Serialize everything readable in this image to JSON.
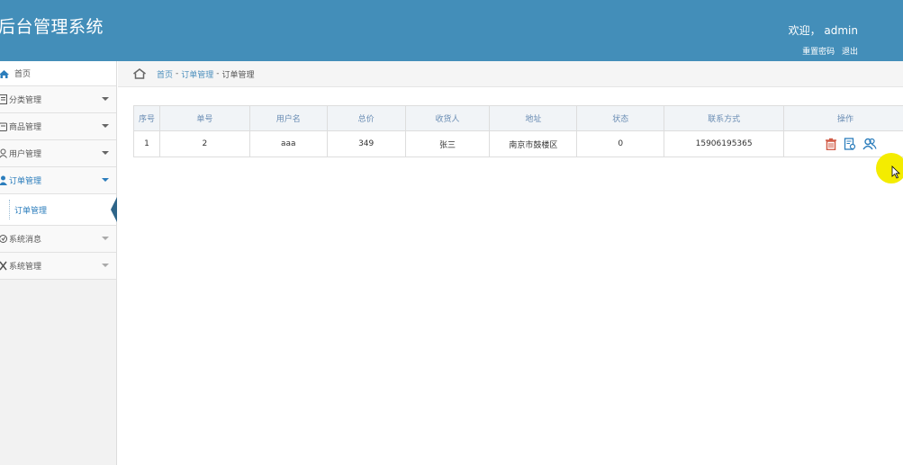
{
  "header": {
    "logo": "后台管理系统",
    "welcome": "欢迎，  admin",
    "reset_password": "重置密码",
    "logout": "退出"
  },
  "sidebar": {
    "home": "首页",
    "items": [
      {
        "label": "分类管理"
      },
      {
        "label": "商品管理"
      },
      {
        "label": "用户管理"
      },
      {
        "label": "订单管理",
        "sub": "订单管理"
      },
      {
        "label": "系统消息"
      },
      {
        "label": "系统管理"
      }
    ]
  },
  "breadcrumb": {
    "home": "首页",
    "sep": "-",
    "parent": "订单管理",
    "current": "订单管理"
  },
  "table": {
    "columns": [
      "序号",
      "单号",
      "用户名",
      "总价",
      "收货人",
      "地址",
      "状态",
      "联系方式",
      "操作"
    ],
    "rows": [
      [
        "1",
        "2",
        "aaa",
        "349",
        "张三",
        "南京市鼓楼区",
        "0",
        "15906195365"
      ]
    ]
  },
  "colors": {
    "header_bg": "#438eb9",
    "link": "#4c8fbd",
    "delete": "#d15b47",
    "action": "#2b7dbc"
  },
  "icons": {
    "delete": "trash-icon",
    "detail": "document-icon",
    "users": "users-icon"
  }
}
